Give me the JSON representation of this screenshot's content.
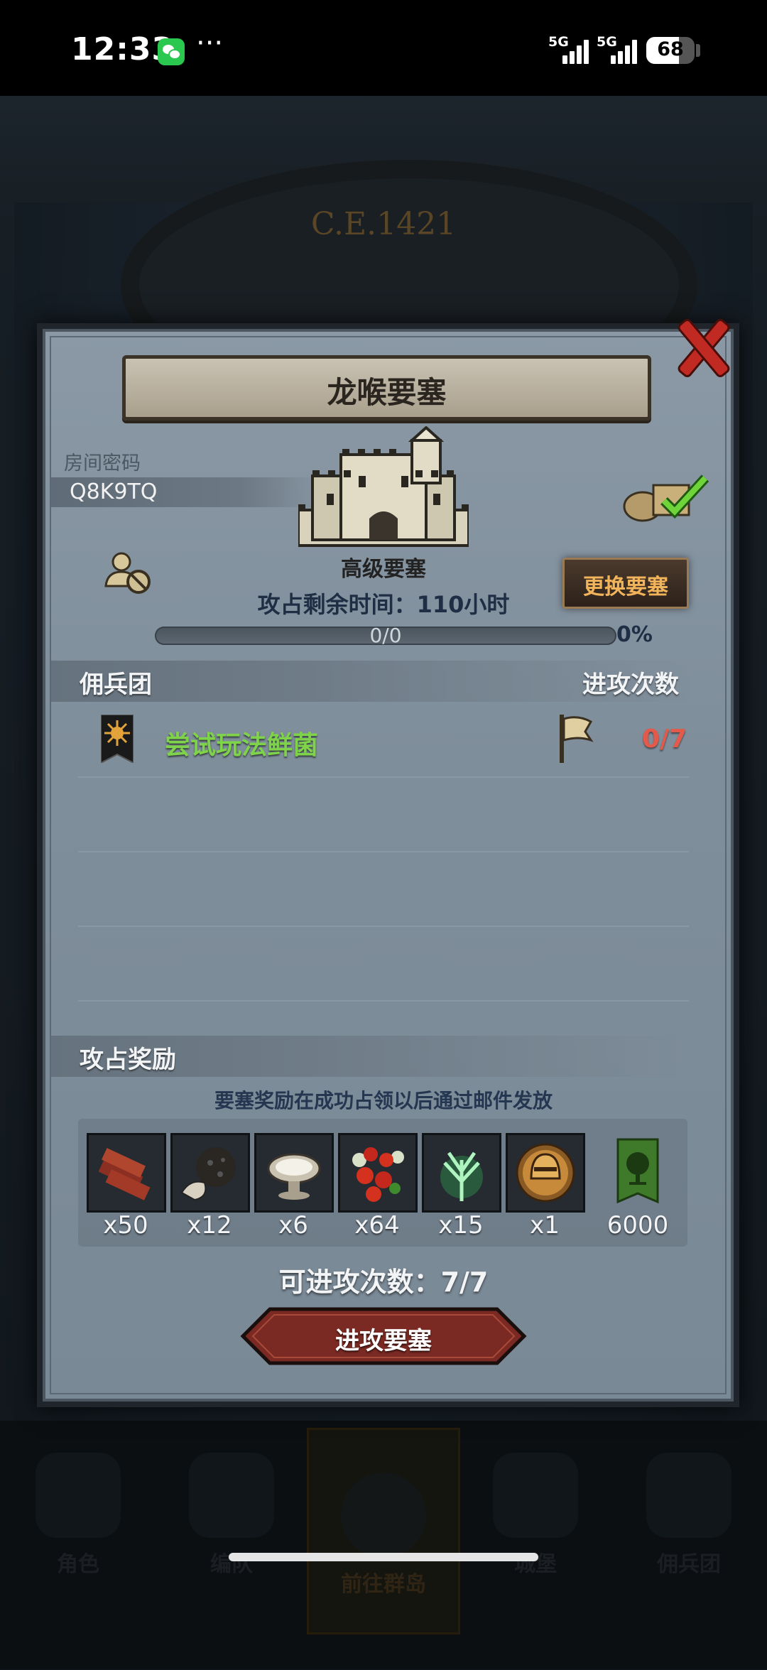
{
  "status_bar": {
    "time": "12:33",
    "dots": "···",
    "signal1": "5G",
    "signal2": "5G",
    "battery": "68",
    "battery_level_percent": 68
  },
  "background": {
    "era_text": "C.E.1421",
    "nav": [
      {
        "label": "角色",
        "icon": "knight-icon"
      },
      {
        "label": "编队",
        "icon": "helmet-icon"
      },
      {
        "label": "前往群岛",
        "icon": "compass-icon",
        "active": true
      },
      {
        "label": "城堡",
        "icon": "castle-icon"
      },
      {
        "label": "佣兵团",
        "icon": "mercenary-icon"
      }
    ]
  },
  "modal": {
    "title": "龙喉要塞",
    "room_label": "房间密码",
    "room_code": "Q8K9TQ",
    "fortress_type": "高级要塞",
    "time_left": "攻占剩余时间：110小时",
    "progress_text": "0/0",
    "progress_percent_text": "0%",
    "progress_value": 0,
    "swap_button": "更换要塞",
    "mercenary_header": "佣兵团",
    "attack_count_header": "进攻次数",
    "guild_name": "尝试玩法鲜菌",
    "guild_attack_count": "0/7",
    "rewards_header": "攻占奖励",
    "rewards_note": "要塞奖励在成功占领以后通过邮件发放",
    "rewards": [
      {
        "icon": "wood-icon",
        "qty": "x50"
      },
      {
        "icon": "truffle-icon",
        "qty": "x12"
      },
      {
        "icon": "bowl-icon",
        "qty": "x6"
      },
      {
        "icon": "berries-icon",
        "qty": "x64"
      },
      {
        "icon": "herb-icon",
        "qty": "x15"
      },
      {
        "icon": "helmet-medal-icon",
        "qty": "x1"
      },
      {
        "icon": "tree-banner-icon",
        "qty": "6000"
      }
    ],
    "attempts_text": "可进攻次数：7/7",
    "attack_button": "进攻要塞"
  },
  "colors": {
    "guild_name": "#7fd34a",
    "attack_count": "#e35a4a",
    "swap_button_text": "#f2b45a",
    "close_button": "#c02a22"
  }
}
